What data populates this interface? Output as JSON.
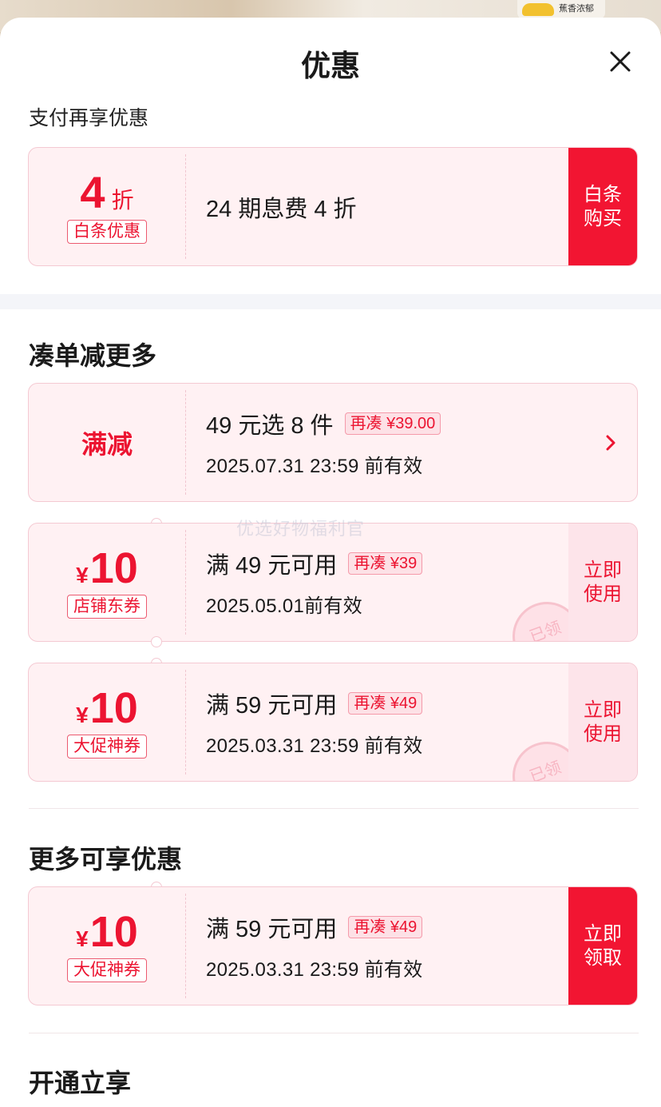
{
  "header": {
    "title": "优惠"
  },
  "payment": {
    "subtitle": "支付再享优惠",
    "card": {
      "value": "4",
      "unit": "折",
      "tag": "白条优惠",
      "description": "24 期息费 4 折",
      "button": "白条购买"
    }
  },
  "bundle": {
    "title": "凑单减更多",
    "promo": {
      "label": "满减",
      "text": "49 元选 8 件",
      "pill": "再凑 ¥39.00",
      "expiry": "2025.07.31 23:59 前有效"
    },
    "coupons": [
      {
        "currency": "¥",
        "amount": "10",
        "tag": "店铺东券",
        "condition": "满 49 元可用",
        "pill": "再凑 ¥39",
        "expiry": "2025.05.01前有效",
        "button": "立即使用",
        "stamp": "已领"
      },
      {
        "currency": "¥",
        "amount": "10",
        "tag": "大促神券",
        "condition": "满 59 元可用",
        "pill": "再凑 ¥49",
        "expiry": "2025.03.31 23:59 前有效",
        "button": "立即使用",
        "stamp": "已领"
      }
    ]
  },
  "more": {
    "title": "更多可享优惠",
    "coupon": {
      "currency": "¥",
      "amount": "10",
      "tag": "大促神券",
      "condition": "满 59 元可用",
      "pill": "再凑 ¥49",
      "expiry": "2025.03.31 23:59 前有效",
      "button": "立即领取"
    }
  },
  "membership": {
    "title": "开通立享"
  },
  "watermark": "优选好物福利官",
  "backdrop_text": "蕉香浓郁",
  "colors": {
    "accent": "#f21532",
    "accent_text": "#ec1431",
    "card_bg": "#fff1f3"
  }
}
